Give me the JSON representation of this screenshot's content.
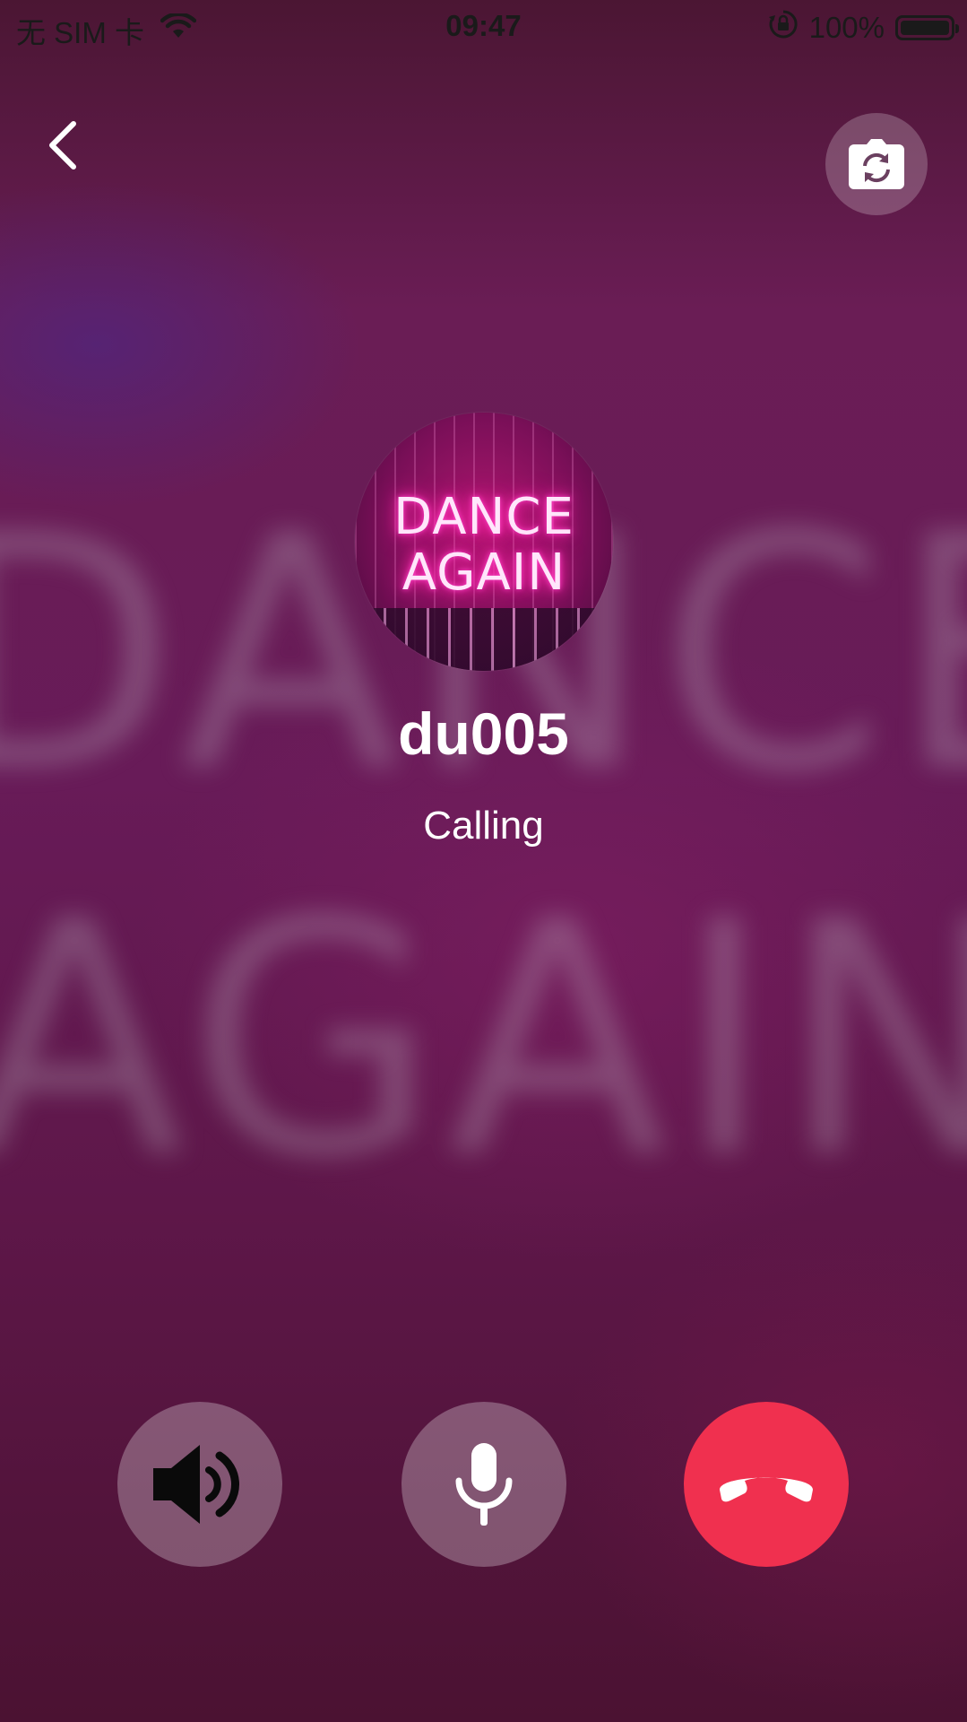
{
  "status_bar": {
    "carrier": "无 SIM 卡",
    "time": "09:47",
    "battery": "100%",
    "icons": [
      "wifi-icon",
      "orientation-lock-icon",
      "battery-icon"
    ]
  },
  "header": {
    "back_icon": "chevron-left-icon",
    "camera_switch_icon": "camera-switch-icon"
  },
  "avatar": {
    "line1": "DANCE",
    "line2": "AGAIN"
  },
  "background": {
    "blur_line1": "DANCE",
    "blur_line2": "AGAIN"
  },
  "call": {
    "name": "du005",
    "status": "Calling"
  },
  "controls": {
    "speaker_icon": "speaker-icon",
    "mic_icon": "microphone-icon",
    "hangup_icon": "phone-hangup-icon",
    "hangup_color": "#f0304f"
  }
}
